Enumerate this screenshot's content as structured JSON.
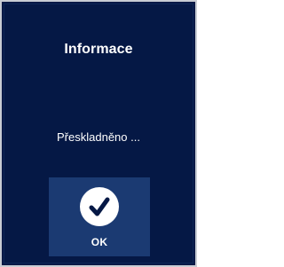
{
  "dialog": {
    "title": "Informace",
    "message": "Přeskladněno ...",
    "ok_label": "OK",
    "ok_icon": "checkmark-icon"
  },
  "colors": {
    "background": "#051845",
    "button": "#1b3a72",
    "text": "#ffffff",
    "border": "#c9ccd3"
  }
}
